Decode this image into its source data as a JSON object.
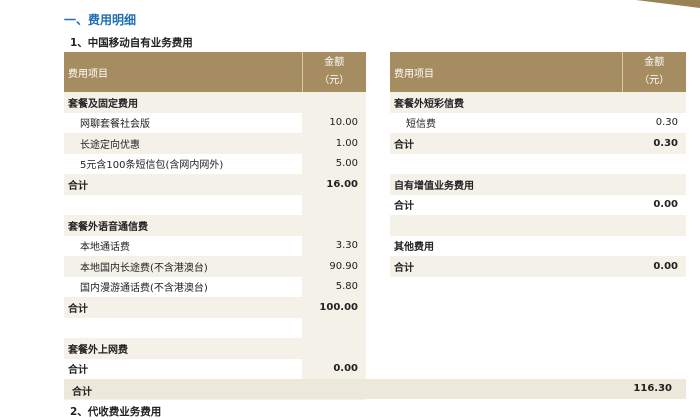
{
  "section_title": "一、费用明细",
  "subtitle": "1、中国移动自有业务费用",
  "subtitle2": "2、代收费业务费用",
  "header": {
    "item": "费用项目",
    "amount": "金额",
    "unit": "（元）"
  },
  "left_rows": [
    {
      "kind": "group",
      "name": "套餐及固定费用",
      "amount": ""
    },
    {
      "kind": "item",
      "name": "网聊套餐社会版",
      "amount": "10.00"
    },
    {
      "kind": "item",
      "name": "长途定向优惠",
      "amount": "1.00"
    },
    {
      "kind": "item",
      "name": "5元含100条短信包(含网内网外)",
      "amount": "5.00"
    },
    {
      "kind": "total",
      "name": "合计",
      "amount": "16.00"
    },
    {
      "kind": "blank",
      "name": "",
      "amount": ""
    },
    {
      "kind": "group",
      "name": "套餐外语音通信费",
      "amount": ""
    },
    {
      "kind": "item",
      "name": "本地通话费",
      "amount": "3.30"
    },
    {
      "kind": "item",
      "name": "本地国内长途费(不含港澳台)",
      "amount": "90.90"
    },
    {
      "kind": "item",
      "name": "国内漫游通话费(不含港澳台)",
      "amount": "5.80"
    },
    {
      "kind": "total",
      "name": "合计",
      "amount": "100.00"
    },
    {
      "kind": "blank",
      "name": "",
      "amount": ""
    },
    {
      "kind": "group",
      "name": "套餐外上网费",
      "amount": ""
    },
    {
      "kind": "total",
      "name": "合计",
      "amount": "0.00"
    },
    {
      "kind": "blank",
      "name": "",
      "amount": ""
    }
  ],
  "right_rows": [
    {
      "kind": "group",
      "name": "套餐外短彩信费",
      "amount": ""
    },
    {
      "kind": "item",
      "name": "短信费",
      "amount": "0.30"
    },
    {
      "kind": "total",
      "name": "合计",
      "amount": "0.30"
    },
    {
      "kind": "blank",
      "name": "",
      "amount": ""
    },
    {
      "kind": "group",
      "name": "自有增值业务费用",
      "amount": ""
    },
    {
      "kind": "total",
      "name": "合计",
      "amount": "0.00"
    },
    {
      "kind": "blank",
      "name": "",
      "amount": ""
    },
    {
      "kind": "group",
      "name": "其他费用",
      "amount": ""
    },
    {
      "kind": "total",
      "name": "合计",
      "amount": "0.00"
    }
  ],
  "grand_total": {
    "label": "合计",
    "amount": "116.30"
  }
}
